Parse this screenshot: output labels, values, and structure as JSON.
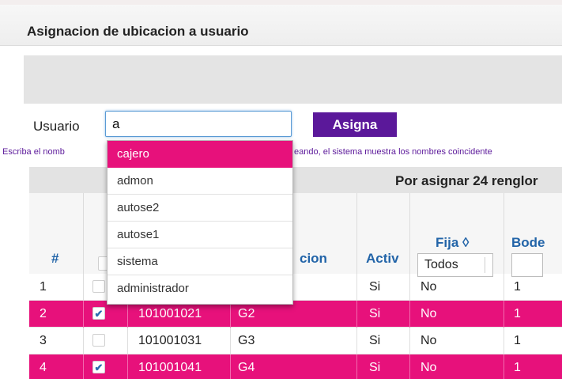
{
  "panel": {
    "title": "Asignacion de ubicacion a usuario"
  },
  "form": {
    "user_label": "Usuario",
    "user_value": "a",
    "assign_label": "Asigna",
    "hint_start": "Escriba el nomb",
    "hint_end": "eando, el sistema muestra los nombres coincidente"
  },
  "autocomplete": {
    "items": [
      "cajero",
      "admon",
      "autose2",
      "autose1",
      "sistema",
      "administrador"
    ],
    "highlighted": "cajero"
  },
  "grid": {
    "band_text": "Por asignar 24 renglor",
    "headers": {
      "num": "#",
      "ubicacion": "cion",
      "activo": "Activ",
      "fija": "Fija ◊",
      "bodega": "Bode"
    },
    "fija_filter": "Todos",
    "rows": [
      {
        "num": "1",
        "checked": false,
        "clave": "",
        "nombre": "",
        "activo": "Si",
        "fija": "No",
        "bodega": "1"
      },
      {
        "num": "2",
        "checked": true,
        "clave": "101001021",
        "nombre": "G2",
        "activo": "Si",
        "fija": "No",
        "bodega": "1"
      },
      {
        "num": "3",
        "checked": false,
        "clave": "101001031",
        "nombre": "G3",
        "activo": "Si",
        "fija": "No",
        "bodega": "1"
      },
      {
        "num": "4",
        "checked": true,
        "clave": "101001041",
        "nombre": "G4",
        "activo": "Si",
        "fija": "No",
        "bodega": "1"
      }
    ]
  },
  "colors": {
    "accent": "#5b189a",
    "highlight": "#e7117b",
    "link": "#2264a8"
  }
}
